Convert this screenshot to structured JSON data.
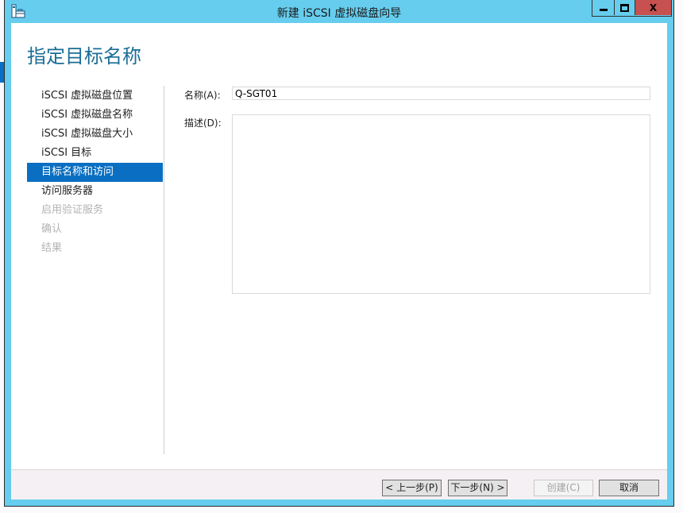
{
  "window": {
    "title": "新建 iSCSI 虚拟磁盘向导",
    "controls": {
      "minimize": "minimize",
      "maximize": "maximize",
      "close": "X"
    }
  },
  "page": {
    "title": "指定目标名称"
  },
  "nav": {
    "items": [
      {
        "label": "iSCSI 虚拟磁盘位置",
        "state": "normal"
      },
      {
        "label": "iSCSI 虚拟磁盘名称",
        "state": "normal"
      },
      {
        "label": "iSCSI 虚拟磁盘大小",
        "state": "normal"
      },
      {
        "label": "iSCSI 目标",
        "state": "normal"
      },
      {
        "label": "目标名称和访问",
        "state": "active"
      },
      {
        "label": "访问服务器",
        "state": "normal"
      },
      {
        "label": "启用验证服务",
        "state": "disabled"
      },
      {
        "label": "确认",
        "state": "disabled"
      },
      {
        "label": "结果",
        "state": "disabled"
      }
    ]
  },
  "form": {
    "name_label": "名称(A):",
    "name_value": "Q-SGT01",
    "description_label": "描述(D):",
    "description_value": ""
  },
  "footer": {
    "previous": "< 上一步(P)",
    "next": "下一步(N) >",
    "create": "创建(C)",
    "cancel": "取消"
  },
  "colors": {
    "frame": "#66cdee",
    "accent": "#0a6fc2",
    "title_text": "#1a6d96",
    "close_button": "#c75050"
  }
}
